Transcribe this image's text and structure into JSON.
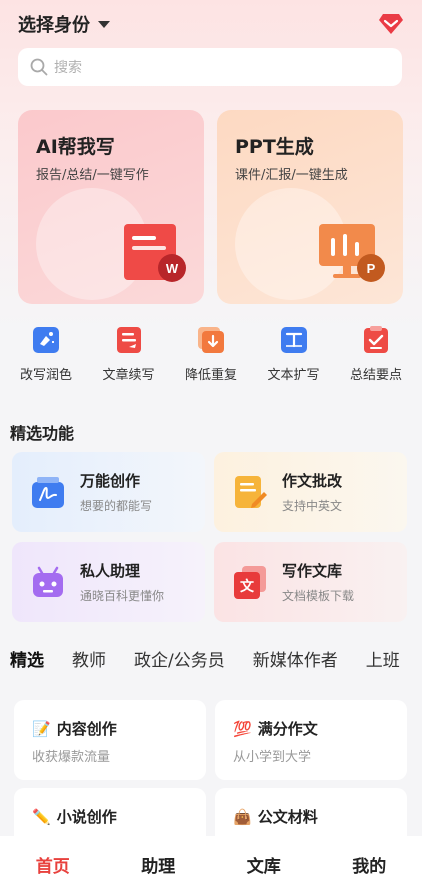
{
  "header": {
    "identity_label": "选择身份",
    "gem_icon": "diamond-icon",
    "gem_color": "#ea3b45"
  },
  "search": {
    "placeholder": "搜索"
  },
  "cards": [
    {
      "title": "AI帮我写",
      "subtitle": "报告/总结/一键写作",
      "badge": "W"
    },
    {
      "title": "PPT生成",
      "subtitle": "课件/汇报/一键生成",
      "badge": "P"
    }
  ],
  "tools": [
    {
      "label": "改写润色",
      "icon": "polish-icon"
    },
    {
      "label": "文章续写",
      "icon": "continue-writing-icon"
    },
    {
      "label": "降低重复",
      "icon": "reduce-duplication-icon"
    },
    {
      "label": "文本扩写",
      "icon": "expand-text-icon"
    },
    {
      "label": "总结要点",
      "icon": "summary-icon"
    }
  ],
  "featured": {
    "title": "精选功能",
    "items": [
      {
        "title": "万能创作",
        "subtitle": "想要的都能写",
        "icon": "universal-creation-icon"
      },
      {
        "title": "作文批改",
        "subtitle": "支持中英文",
        "icon": "essay-correction-icon"
      },
      {
        "title": "私人助理",
        "subtitle": "通晓百科更懂你",
        "icon": "robot-assistant-icon"
      },
      {
        "title": "写作文库",
        "subtitle": "文档模板下载",
        "icon": "writing-library-icon"
      }
    ]
  },
  "tabs": [
    "精选",
    "教师",
    "政企/公务员",
    "新媒体作者",
    "上班"
  ],
  "content_cards": [
    {
      "emoji": "📝",
      "title": "内容创作",
      "subtitle": "收获爆款流量"
    },
    {
      "emoji": "💯",
      "title": "满分作文",
      "subtitle": "从小学到大学"
    },
    {
      "emoji": "✏️",
      "title": "小说创作",
      "subtitle": ""
    },
    {
      "emoji": "👜",
      "title": "公文材料",
      "subtitle": ""
    }
  ],
  "nav": [
    "首页",
    "助理",
    "文库",
    "我的"
  ],
  "colors": {
    "accent": "#e8413d",
    "background": "#f5f5f7"
  }
}
